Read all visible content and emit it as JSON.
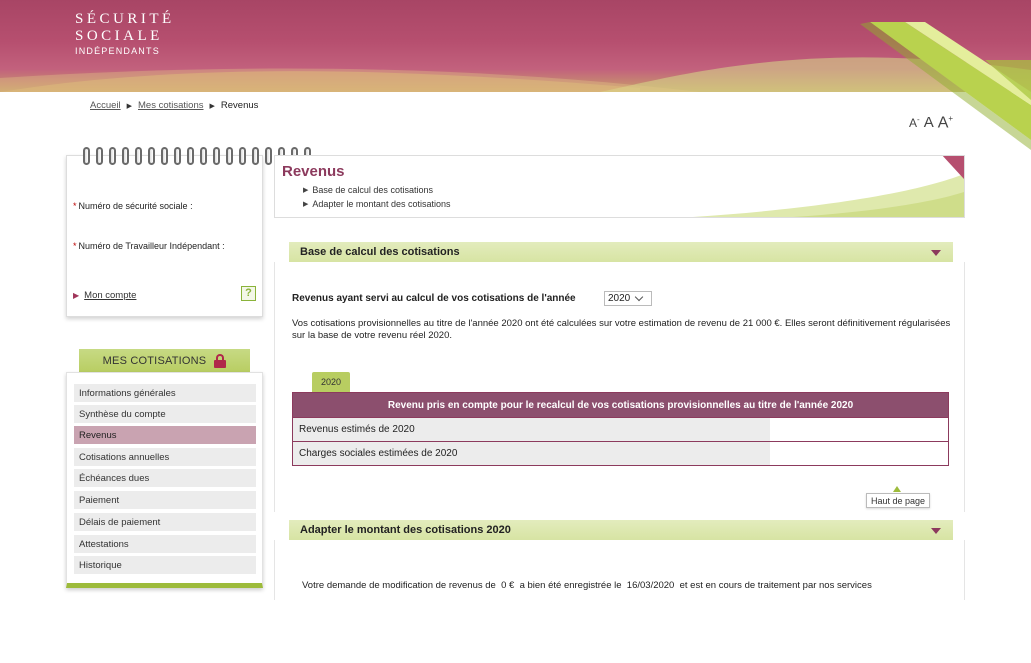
{
  "header": {
    "logo_line1": "SÉCURITÉ",
    "logo_line2": "SOCIALE",
    "logo_line3": "INDÉPENDANTS"
  },
  "breadcrumb": {
    "home": "Accueil",
    "parent": "Mes cotisations",
    "current": "Revenus"
  },
  "font_size_controls": {
    "smaller": "A",
    "smaller_sup": "-",
    "normal": "A",
    "larger": "A",
    "larger_sup": "+"
  },
  "account_card": {
    "ssn_label": "Numéro de sécurité sociale :",
    "worker_label": "Numéro de Travailleur Indépendant :",
    "required_marker": "*",
    "account_link": "Mon compte",
    "help_label": "?"
  },
  "menu": {
    "title": "MES COTISATIONS",
    "items": [
      {
        "label": "Informations générales",
        "active": false
      },
      {
        "label": "Synthèse du compte",
        "active": false
      },
      {
        "label": "Revenus",
        "active": true
      },
      {
        "label": "Cotisations annuelles",
        "active": false
      },
      {
        "label": "Échéances dues",
        "active": false
      },
      {
        "label": "Paiement",
        "active": false
      },
      {
        "label": "Délais de paiement",
        "active": false
      },
      {
        "label": "Attestations",
        "active": false
      },
      {
        "label": "Historique",
        "active": false
      }
    ]
  },
  "page": {
    "title": "Revenus",
    "anchors": [
      "Base de calcul des cotisations",
      "Adapter le montant des cotisations"
    ]
  },
  "section1": {
    "title": "Base de calcul des cotisations",
    "year_label": "Revenus ayant servi au calcul de vos cotisations de l'année",
    "year_selected": "2020",
    "info": "Vos cotisations provisionnelles au titre de l'année 2020 ont été calculées sur votre estimation de revenu de 21 000 €. Elles seront définitivement régularisées sur la base de votre revenu réel 2020.",
    "tab_label": "2020",
    "table_header": "Revenu pris en compte pour le recalcul de vos cotisations provisionnelles au titre de l'année 2020",
    "rows": [
      {
        "label": "Revenus estimés de 2020",
        "value": ""
      },
      {
        "label": "Charges sociales estimées de 2020",
        "value": ""
      }
    ],
    "back_to_top": "Haut de page"
  },
  "section2": {
    "title": "Adapter le montant des cotisations 2020",
    "confirmation": "Votre demande de modification de revenus de  0 €  a bien été enregistrée le  16/03/2020  et est en cours de traitement par nos services"
  },
  "colors": {
    "brand_plum": "#8c3a5d",
    "accent_green": "#b8cd61",
    "table_header_bg": "#8c4f6e"
  }
}
